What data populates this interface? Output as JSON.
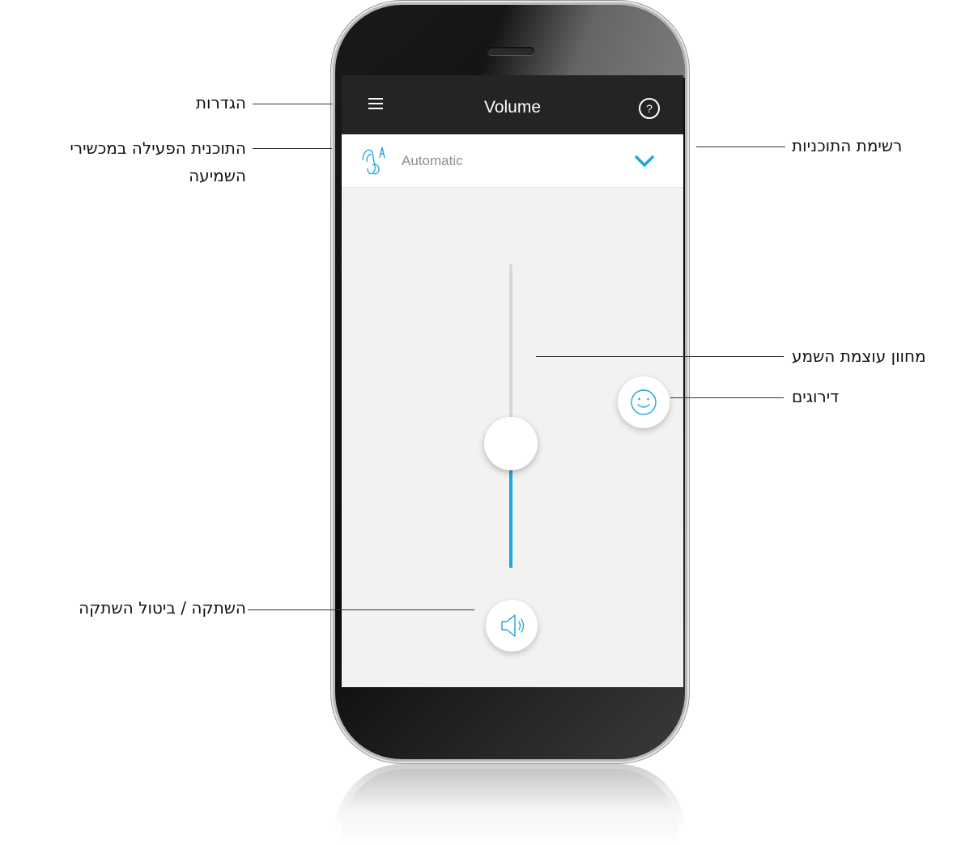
{
  "app": {
    "title": "Volume",
    "program": {
      "name": "Automatic",
      "icon": "hearing-aid-automatic-icon"
    },
    "icons": {
      "menu": "hamburger-menu-icon",
      "help": "help-circle-icon",
      "help_glyph": "?",
      "dropdown": "chevron-down-icon",
      "rating": "smiley-face-icon",
      "mute": "speaker-volume-icon"
    },
    "volume_level": 0.41,
    "colors": {
      "accent": "#1ea6de",
      "app_bar": "#242424",
      "screen_bg": "#f2f2f1"
    }
  },
  "callouts": {
    "settings": "הגדרות",
    "active_program_line1": "התוכנית הפעילה במכשירי",
    "active_program_line2": "השמיעה",
    "program_list": "רשימת התוכניות",
    "volume_indicator": "מחוון עוצמת השמע",
    "ratings": "דירוגים",
    "mute": "השתקה / ביטול השתקה"
  }
}
